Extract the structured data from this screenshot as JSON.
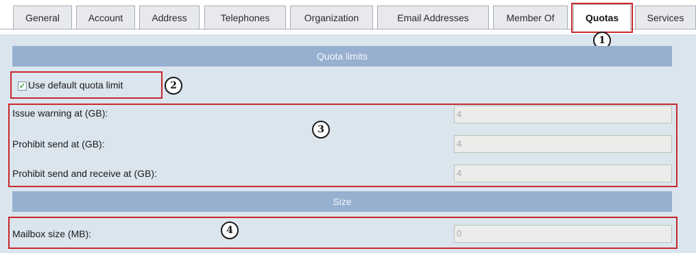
{
  "tabs": [
    {
      "label": "General"
    },
    {
      "label": "Account"
    },
    {
      "label": "Address"
    },
    {
      "label": "Telephones"
    },
    {
      "label": "Organization"
    },
    {
      "label": "Email Addresses"
    },
    {
      "label": "Member Of"
    },
    {
      "label": "Quotas",
      "active": true
    },
    {
      "label": "Services"
    }
  ],
  "quota": {
    "header": "Quota limits",
    "use_default": {
      "label": "Use default quota limit",
      "checked": true
    },
    "fields": [
      {
        "label": "Issue warning at (GB):",
        "value": "4"
      },
      {
        "label": "Prohibit send at (GB):",
        "value": "4"
      },
      {
        "label": "Prohibit send and receive at (GB):",
        "value": "4"
      }
    ]
  },
  "size": {
    "header": "Size",
    "mailbox": {
      "label": "Mailbox size (MB):",
      "value": "0"
    }
  },
  "callouts": [
    "1",
    "2",
    "3",
    "4"
  ],
  "colors": {
    "highlight": "#c8272b",
    "section_header": "#97b0cf",
    "background": "#dbe5ee"
  }
}
